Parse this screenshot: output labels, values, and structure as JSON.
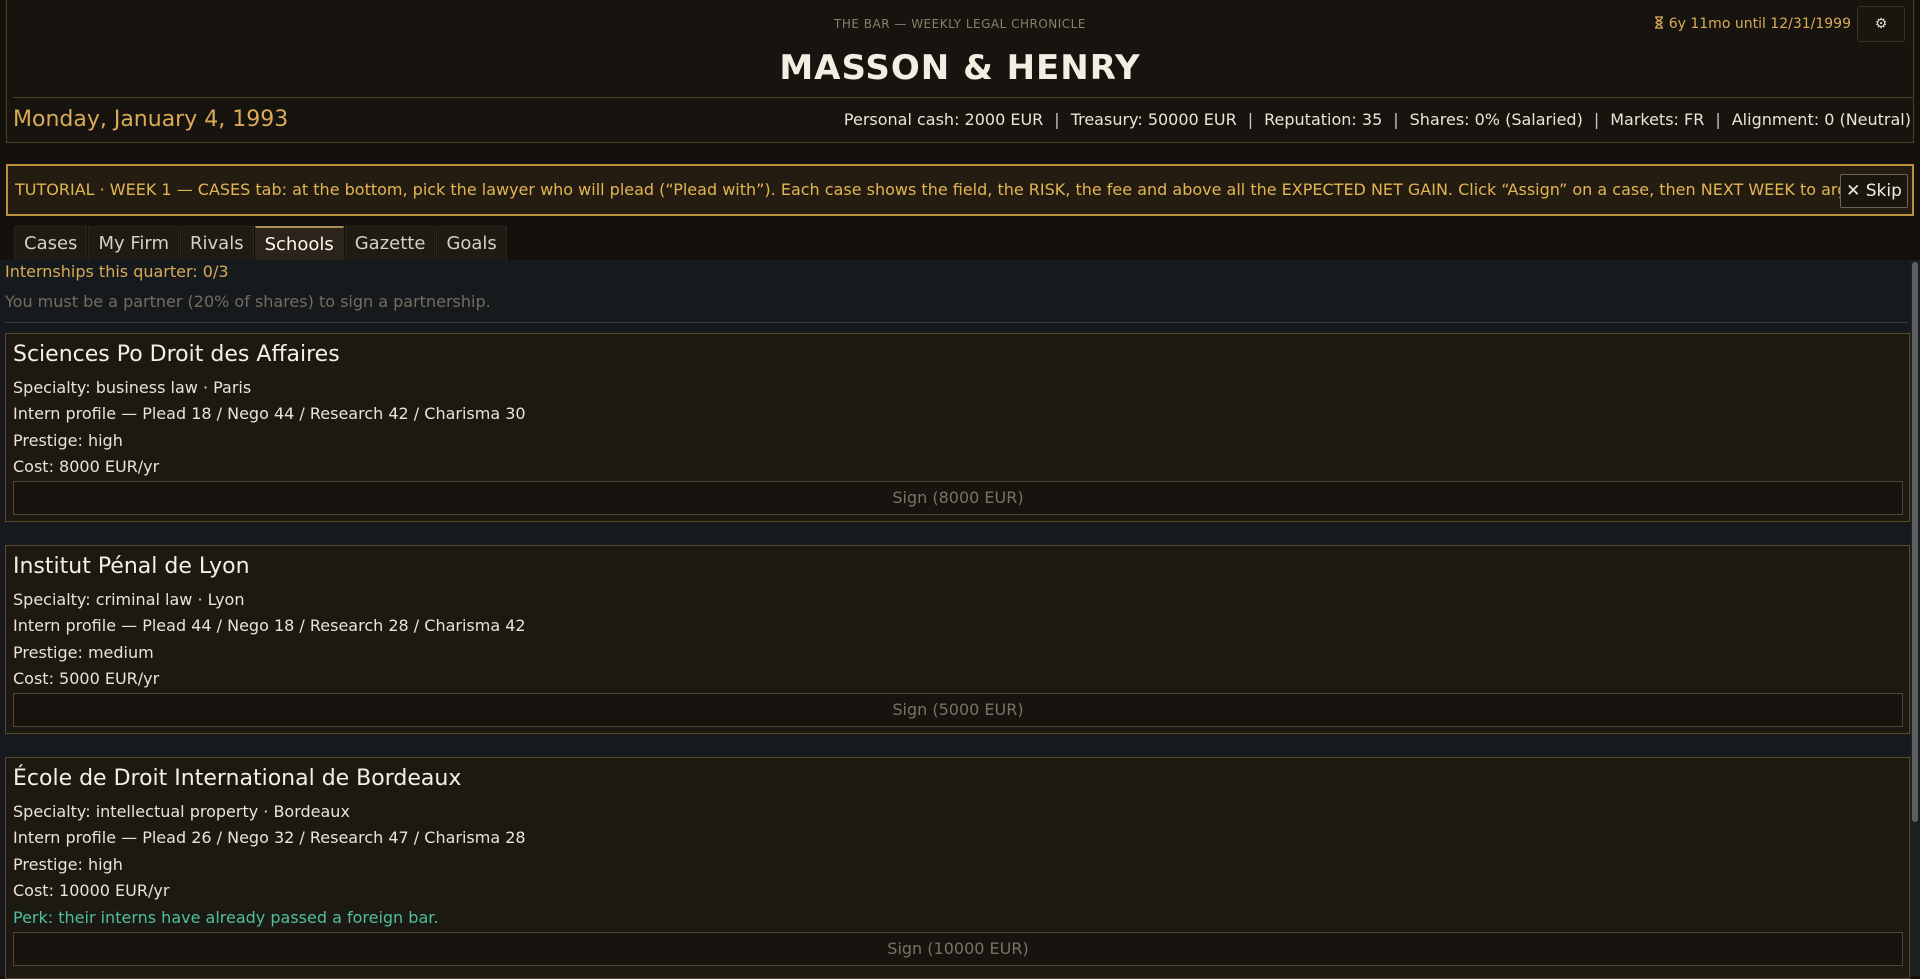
{
  "header": {
    "kicker": "THE BAR  —  WEEKLY LEGAL CHRONICLE",
    "firm_name": "MASSON & HENRY",
    "date": "Monday, January 4, 1993",
    "timer_icon": "hourglass-icon",
    "timer": "6y 11mo until 12/31/1999",
    "settings_icon": "gear-icon",
    "settings_glyph": "⚙",
    "stats": [
      "Personal cash: 2000 EUR",
      "Treasury: 50000 EUR",
      "Reputation: 35",
      "Shares: 0% (Salaried)",
      "Markets: FR",
      "Alignment: 0 (Neutral)"
    ],
    "separator": "|"
  },
  "tutorial": {
    "text": "TUTORIAL · WEEK 1 — CASES tab: at the bottom, pick the lawyer who will plead (“Plead with”). Each case shows the field, the RISK, the fee and above all the EXPECTED NET GAIN. Click “Assign” on a case, then NEXT WEEK to argue it.",
    "skip_label": "✕ Skip",
    "accent_color": "#b8913c"
  },
  "tabs": [
    {
      "label": "Cases",
      "active": false
    },
    {
      "label": "My Firm",
      "active": false
    },
    {
      "label": "Rivals",
      "active": false
    },
    {
      "label": "Schools",
      "active": true
    },
    {
      "label": "Gazette",
      "active": false
    },
    {
      "label": "Goals",
      "active": false
    }
  ],
  "schools_panel": {
    "quota": "Internships this quarter: 0/3",
    "partner_note": "You must be a partner (20% of shares) to sign a partnership.",
    "schools": [
      {
        "name": "Sciences Po Droit des Affaires",
        "specialty": "Specialty: business law  ·  Paris",
        "profile": "Intern profile — Plead 18 / Nego 44 / Research 42 / Charisma 30",
        "prestige": "Prestige: high",
        "cost": "Cost: 8000 EUR/yr",
        "perk": "",
        "sign_label": "Sign (8000 EUR)"
      },
      {
        "name": "Institut Pénal de Lyon",
        "specialty": "Specialty: criminal law  ·  Lyon",
        "profile": "Intern profile — Plead 44 / Nego 18 / Research 28 / Charisma 42",
        "prestige": "Prestige: medium",
        "cost": "Cost: 5000 EUR/yr",
        "perk": "",
        "sign_label": "Sign (5000 EUR)"
      },
      {
        "name": "École de Droit International de Bordeaux",
        "specialty": "Specialty: intellectual property  ·  Bordeaux",
        "profile": "Intern profile — Plead 26 / Nego 32 / Research 47 / Charisma 28",
        "prestige": "Prestige: high",
        "cost": "Cost: 10000 EUR/yr",
        "perk": "Perk: their interns have already passed a foreign bar.",
        "sign_label": "Sign (10000 EUR)"
      }
    ]
  }
}
